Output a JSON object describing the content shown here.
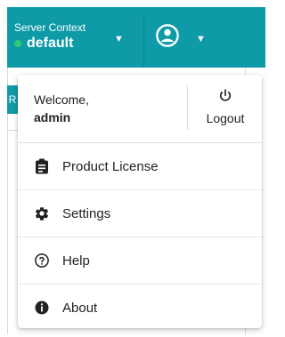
{
  "header": {
    "context_title": "Server Context",
    "context_value": "default",
    "context_status_color": "#2ecc71",
    "accent": "#0e9aa7",
    "user_icon": "account-circle-icon"
  },
  "menu": {
    "welcome_text": "Welcome,",
    "username": "admin",
    "logout_label": "Logout",
    "items": [
      {
        "label": "Product License",
        "icon": "clipboard-icon"
      },
      {
        "label": "Settings",
        "icon": "gear-icon"
      },
      {
        "label": "Help",
        "icon": "help-circle-icon"
      },
      {
        "label": "About",
        "icon": "info-icon"
      }
    ]
  },
  "background": {
    "tab_label": "R"
  }
}
